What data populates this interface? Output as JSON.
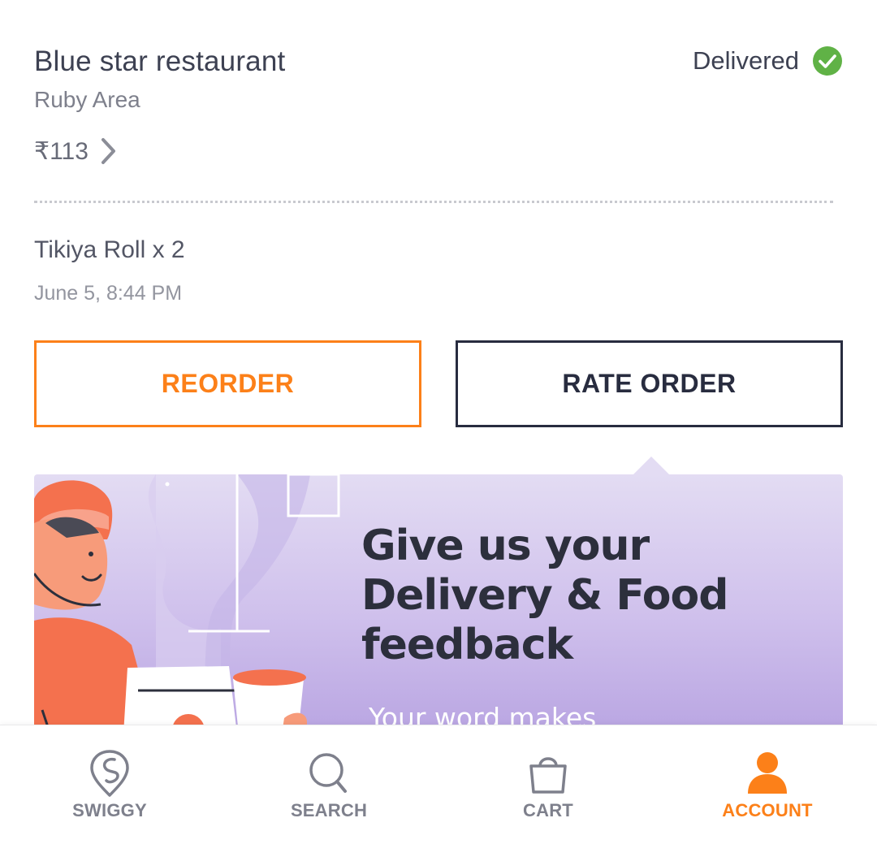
{
  "order": {
    "restaurant": "Blue star restaurant",
    "area": "Ruby Area",
    "price": "₹113",
    "status": "Delivered",
    "items": "Tikiya Roll x 2",
    "date": "June 5, 8:44 PM",
    "reorder_label": "REORDER",
    "rate_label": "RATE ORDER"
  },
  "banner": {
    "title": "Give us your Delivery & Food feedback",
    "subtitle": "Your word makes"
  },
  "nav": {
    "items": [
      {
        "label": "SWIGGY",
        "icon": "swiggy-logo-icon",
        "active": false
      },
      {
        "label": "SEARCH",
        "icon": "search-icon",
        "active": false
      },
      {
        "label": "CART",
        "icon": "cart-bag-icon",
        "active": false
      },
      {
        "label": "ACCOUNT",
        "icon": "account-person-icon",
        "active": true
      }
    ]
  },
  "colors": {
    "accent": "#fc8019",
    "text_dark": "#3d4152",
    "success": "#60b246",
    "banner_bg": "#cfc0ec"
  }
}
